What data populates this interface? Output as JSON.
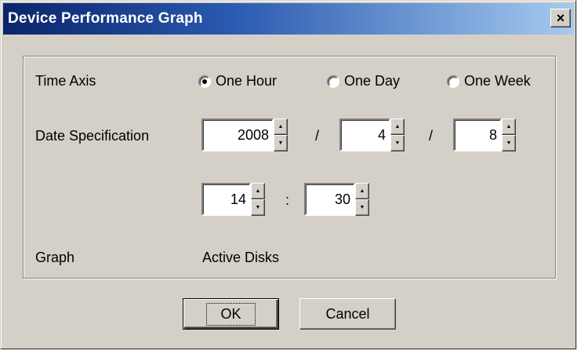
{
  "window": {
    "title": "Device Performance Graph",
    "close_label": "×"
  },
  "time_axis": {
    "label": "Time Axis",
    "options": [
      {
        "label": "One Hour",
        "checked": true
      },
      {
        "label": "One Day",
        "checked": false
      },
      {
        "label": "One Week",
        "checked": false
      }
    ]
  },
  "date_spec": {
    "label": "Date Specification",
    "year": "2008",
    "month": "4",
    "day": "8",
    "date_separator": "/",
    "hour": "14",
    "minute": "30",
    "time_separator": ":"
  },
  "graph": {
    "label": "Graph",
    "value": "Active Disks"
  },
  "buttons": {
    "ok": "OK",
    "cancel": "Cancel"
  },
  "colors": {
    "face": "#d4d0c8",
    "title_start": "#0a246a",
    "title_end": "#a6caf0"
  },
  "icons": {
    "spin_up": "▲",
    "spin_down": "▼"
  }
}
